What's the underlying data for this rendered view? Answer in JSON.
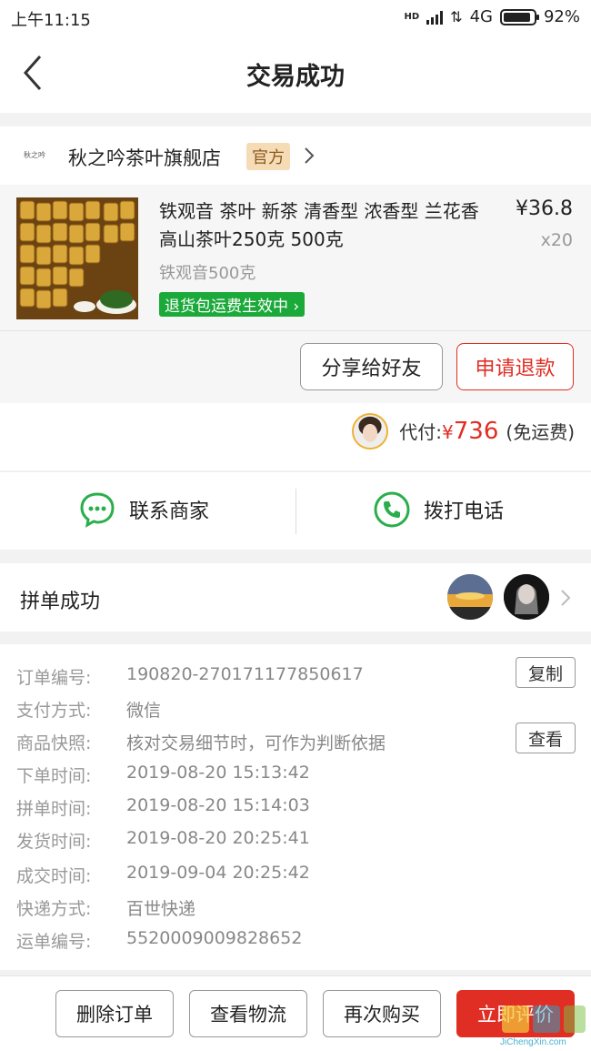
{
  "status_bar": {
    "time": "上午11:15",
    "network": "4G",
    "battery_percent": "92%",
    "hd_label": "HD"
  },
  "header": {
    "title": "交易成功"
  },
  "shop": {
    "logo_text": "秋之吟",
    "name": "秋之吟茶叶旗舰店",
    "official_tag": "官方"
  },
  "product": {
    "title": "铁观音 茶叶 新茶 清香型 浓香型 兰花香 高山茶叶250克 500克",
    "price": "¥36.8",
    "quantity": "x20",
    "spec": "铁观音500克",
    "badge": "退货包运费生效中"
  },
  "actions": {
    "share_label": "分享给好友",
    "refund_label": "申请退款"
  },
  "payment": {
    "label": "代付:",
    "currency": "¥",
    "amount": "736",
    "shipping_note": "(免运费)"
  },
  "contact": {
    "merchant_label": "联系商家",
    "phone_label": "拨打电话"
  },
  "group": {
    "label": "拼单成功"
  },
  "order_details": {
    "rows": [
      {
        "key": "订单编号:",
        "value": "190820-270171177850617"
      },
      {
        "key": "支付方式:",
        "value": "微信"
      },
      {
        "key": "商品快照:",
        "value": "核对交易细节时，可作为判断依据"
      },
      {
        "key": "下单时间:",
        "value": "2019-08-20 15:13:42"
      },
      {
        "key": "拼单时间:",
        "value": "2019-08-20 15:14:03"
      },
      {
        "key": "发货时间:",
        "value": "2019-08-20 20:25:41"
      },
      {
        "key": "成交时间:",
        "value": "2019-09-04 20:25:42"
      },
      {
        "key": "快递方式:",
        "value": "百世快递"
      },
      {
        "key": "运单编号:",
        "value": "5520009009828652"
      }
    ],
    "copy_label": "复制",
    "view_label": "查看"
  },
  "bottom_bar": {
    "delete_label": "删除订单",
    "track_label": "查看物流",
    "rebuy_label": "再次购买",
    "review_label": "立即评价"
  },
  "watermark": {
    "text": "JiChengXin.com"
  },
  "colors": {
    "accent_red": "#e02e24",
    "green_badge": "#1ba93a",
    "official_tag_bg": "#f5dcb6",
    "icon_green": "#2aae4b"
  }
}
